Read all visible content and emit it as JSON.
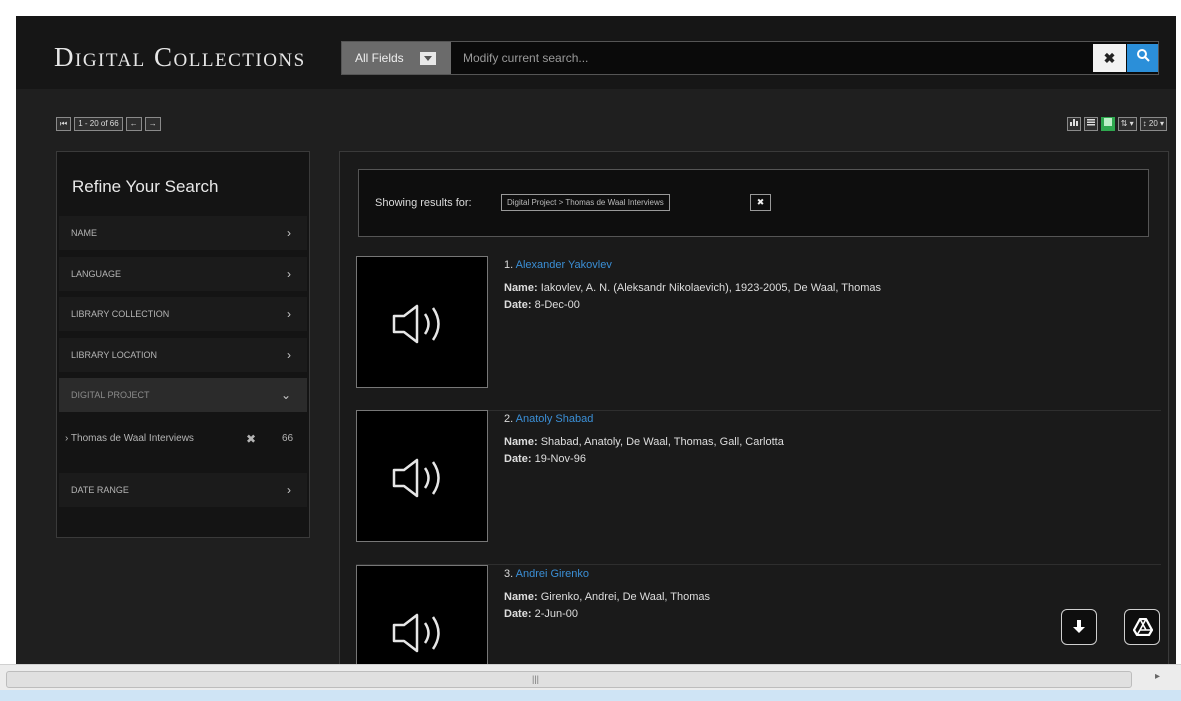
{
  "header": {
    "brand": "Digital Collections",
    "search": {
      "field_label": "All Fields",
      "placeholder": "Modify current search..."
    },
    "icons": {
      "clear": "close-icon",
      "search": "search-icon"
    }
  },
  "pager": {
    "first": "⏮",
    "range": "1 - 20 of 66",
    "prev": "←",
    "next": "→"
  },
  "view_controls": {
    "gallery": "gallery-icon",
    "list": "list-icon",
    "grid": "grid-icon",
    "sort": "⇅ ▾",
    "per_page": "↕ 20 ▾"
  },
  "sidebar": {
    "title": "Refine Your Search",
    "facets": [
      {
        "label": "NAME"
      },
      {
        "label": "LANGUAGE"
      },
      {
        "label": "LIBRARY COLLECTION"
      },
      {
        "label": "LIBRARY LOCATION"
      },
      {
        "label": "DIGITAL PROJECT"
      },
      {
        "label": "DATE RANGE"
      }
    ],
    "selected_value": {
      "label": "› Thomas de Waal Interviews",
      "remove": "✖",
      "count": "66"
    }
  },
  "main": {
    "showing_label": "Showing results for:",
    "filter": "Digital Project > Thomas de Waal Interviews",
    "filter_remove": "✖",
    "results": [
      {
        "num": "1.",
        "title": "Alexander Yakovlev",
        "name_label": "Name:",
        "name": "Iakovlev, A. N. (Aleksandr Nikolaevich), 1923-2005, De Waal, Thomas",
        "date_label": "Date:",
        "date": "8-Dec-00"
      },
      {
        "num": "2.",
        "title": "Anatoly Shabad",
        "name_label": "Name:",
        "name": "Shabad, Anatoly, De Waal, Thomas, Gall, Carlotta",
        "date_label": "Date:",
        "date": "19-Nov-96"
      },
      {
        "num": "3.",
        "title": "Andrei Girenko",
        "name_label": "Name:",
        "name": "Girenko, Andrei, De Waal, Thomas",
        "date_label": "Date:",
        "date": "2-Jun-00"
      }
    ]
  },
  "floating": {
    "download": "download-icon",
    "drive": "google-drive-icon"
  },
  "scrollbar": {
    "grip": "|||"
  },
  "colors": {
    "accent": "#2b8fd9",
    "link": "#3b8fd6",
    "active_view": "#2fa84f"
  }
}
